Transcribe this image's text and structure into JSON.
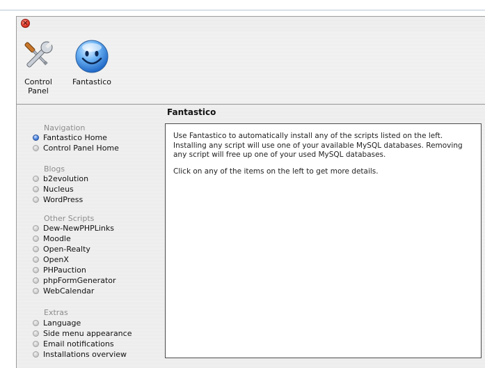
{
  "window": {
    "close_glyph": "×"
  },
  "toolbar": {
    "control_panel_label": "Control Panel",
    "fantastico_label": "Fantastico"
  },
  "main": {
    "title": "Fantastico",
    "paragraph1": "Use Fantastico to automatically install any of the scripts listed on the left. Installing any script will use one of your available MySQL databases. Removing any script will free up one of your used MySQL databases.",
    "paragraph2": "Click on any of the items on the left to get more details."
  },
  "sidebar": {
    "navigation_heading": "Navigation",
    "navigation": [
      "Fantastico Home",
      "Control Panel Home"
    ],
    "blogs_heading": "Blogs",
    "blogs": [
      "b2evolution",
      "Nucleus",
      "WordPress"
    ],
    "other_heading": "Other Scripts",
    "other": [
      "Dew-NewPHPLinks",
      "Moodle",
      "Open-Realty",
      "OpenX",
      "PHPauction",
      "phpFormGenerator",
      "WebCalendar"
    ],
    "extras_heading": "Extras",
    "extras": [
      "Language",
      "Side menu appearance",
      "Email notifications",
      "Installations overview"
    ]
  },
  "colors": {
    "accent": "#2f63c4",
    "section_heading": "#8c8c8c",
    "close": "#e23a2a"
  },
  "icons": {
    "control_panel": "tools-icon",
    "fantastico": "smiley-icon"
  }
}
